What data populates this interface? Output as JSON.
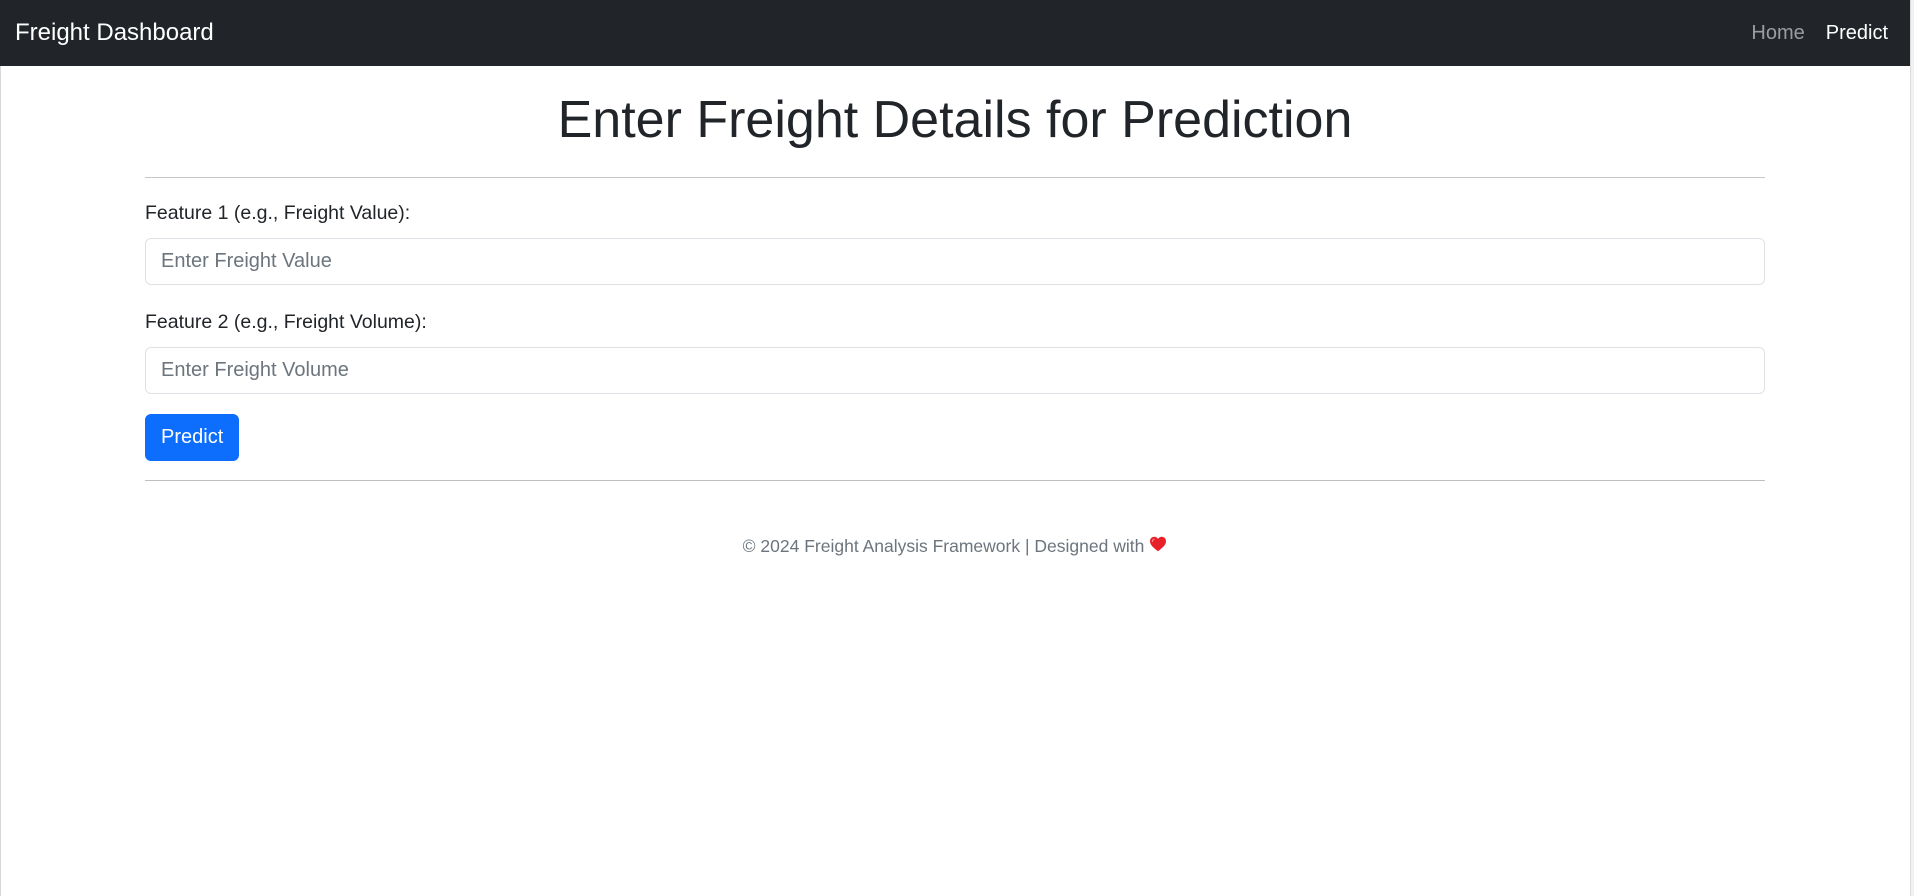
{
  "navbar": {
    "brand": "Freight Dashboard",
    "links": [
      {
        "label": "Home",
        "active": false
      },
      {
        "label": "Predict",
        "active": true
      }
    ]
  },
  "main": {
    "title": "Enter Freight Details for Prediction",
    "fields": [
      {
        "label": "Feature 1 (e.g., Freight Value):",
        "value": "",
        "placeholder": "Enter Freight Value"
      },
      {
        "label": "Feature 2 (e.g., Freight Volume):",
        "value": "",
        "placeholder": "Enter Freight Volume"
      }
    ],
    "submit_label": "Predict"
  },
  "footer": {
    "text": "© 2024 Freight Analysis Framework | Designed with",
    "icon": "heart-icon"
  },
  "colors": {
    "navbar_bg": "#212529",
    "primary": "#0d6efd",
    "heart": "#e8202a"
  }
}
